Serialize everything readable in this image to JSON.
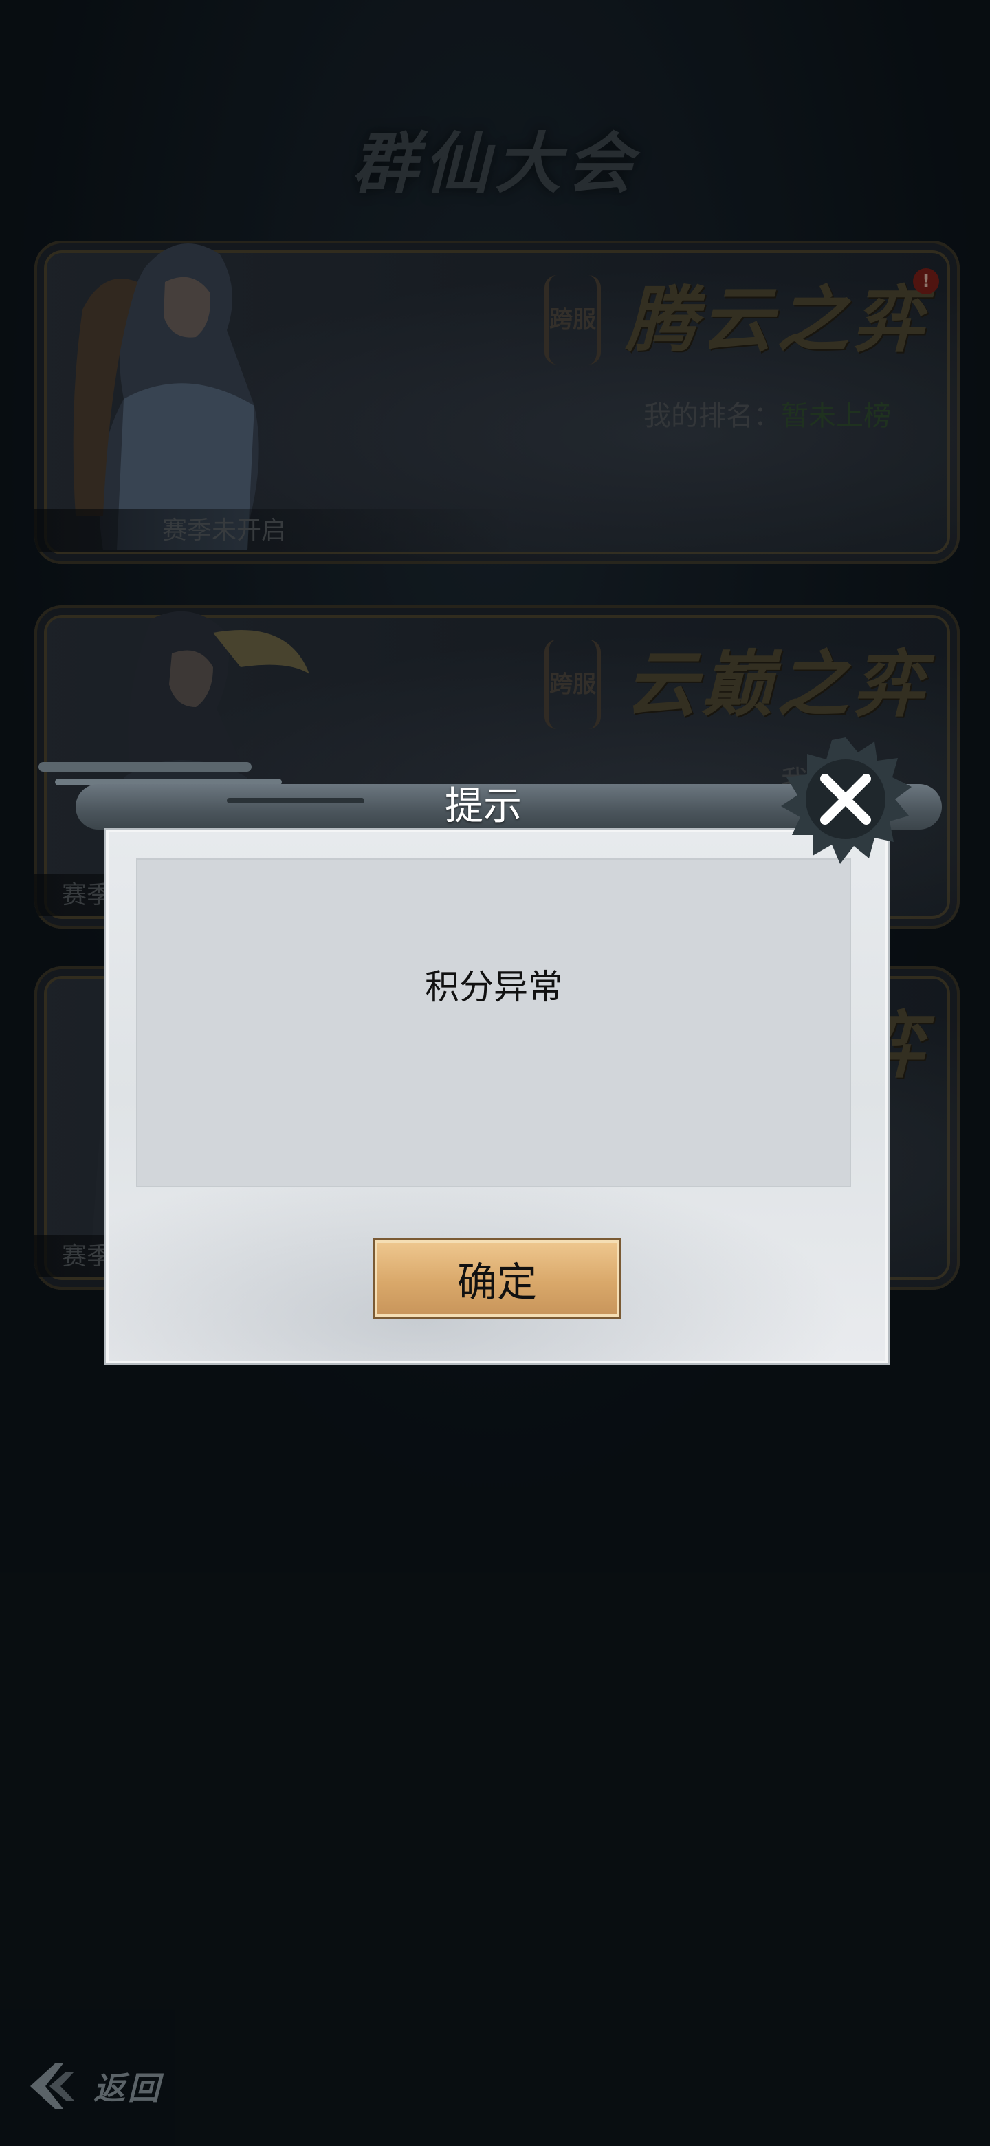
{
  "page_title": "群仙大会",
  "cards": [
    {
      "badge": "跨服",
      "name": "腾云之弈",
      "rank_label": "我的排名：",
      "rank_value": "暂未上榜",
      "season_status": "赛季未开启",
      "alert": "!"
    },
    {
      "badge": "跨服",
      "name": "云巅之弈",
      "rank_label": "我的排名",
      "rank_value": "",
      "season_status": "赛季"
    },
    {
      "badge": "",
      "name": "弈",
      "rank_label": "",
      "rank_value": "",
      "season_status": "赛季"
    }
  ],
  "dialog": {
    "title": "提示",
    "message": "积分异常",
    "confirm_label": "确定",
    "close_icon": "close-icon"
  },
  "footer": {
    "back_label": "返回",
    "back_icon": "back-arrow-icon"
  },
  "colors": {
    "background": "#0b1116",
    "button_gold": "#d9a86a",
    "dialog_panel": "#e3e6e9"
  }
}
